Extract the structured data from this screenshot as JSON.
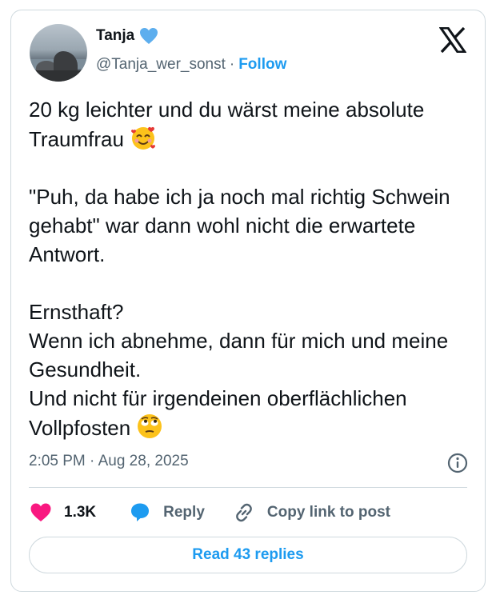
{
  "author": {
    "name": "Tanja",
    "handle": "@Tanja_wer_sonst",
    "separator": "·",
    "follow_label": "Follow",
    "avatar_icon": "avatar-photo-coast",
    "verified_icon": "blue-heart-icon"
  },
  "platform_icon": "x-logo-icon",
  "tweet": {
    "text": "20 kg leichter und du wärst meine absolute Traumfrau ",
    "emoji_1": "smiling-face-with-hearts",
    "paragraph_2": "\"Puh, da habe ich ja noch mal richtig Schwein gehabt\" war dann wohl nicht die erwartete Antwort.",
    "paragraph_3": "Ernsthaft?\nWenn ich abnehme, dann für mich und meine Gesundheit.\nUnd nicht für irgendeinen oberflächlichen Vollpfosten ",
    "emoji_2": "face-with-rolling-eyes"
  },
  "timestamp": "2:05 PM · Aug 28, 2025",
  "actions": {
    "likes_count": "1.3K",
    "reply_label": "Reply",
    "copy_link_label": "Copy link to post"
  },
  "read_replies_label": "Read 43 replies",
  "colors": {
    "accent": "#1d9bf0",
    "like": "#f91880",
    "muted": "#536471",
    "border": "#cfd9de"
  }
}
